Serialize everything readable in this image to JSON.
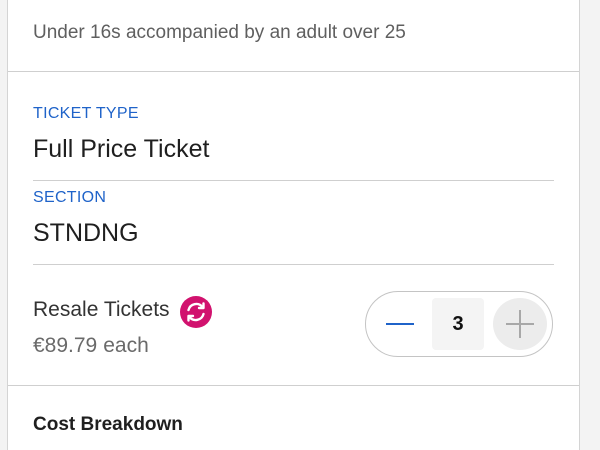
{
  "notice": "Under 16s accompanied by an adult over 25",
  "ticket_type": {
    "label": "TICKET TYPE",
    "value": "Full Price Ticket"
  },
  "section": {
    "label": "SECTION",
    "value": "STNDNG"
  },
  "resale": {
    "title": "Resale Tickets",
    "icon": "resale-icon",
    "price": "€89.79",
    "price_unit": "each",
    "icon_color": "#d1126e"
  },
  "quantity": {
    "value": "3",
    "decrement_icon": "minus-icon",
    "increment_icon": "plus-icon"
  },
  "cost_breakdown": {
    "title": "Cost Breakdown"
  },
  "colors": {
    "label_blue": "#1f63c9",
    "divider": "#cfcfcf"
  }
}
